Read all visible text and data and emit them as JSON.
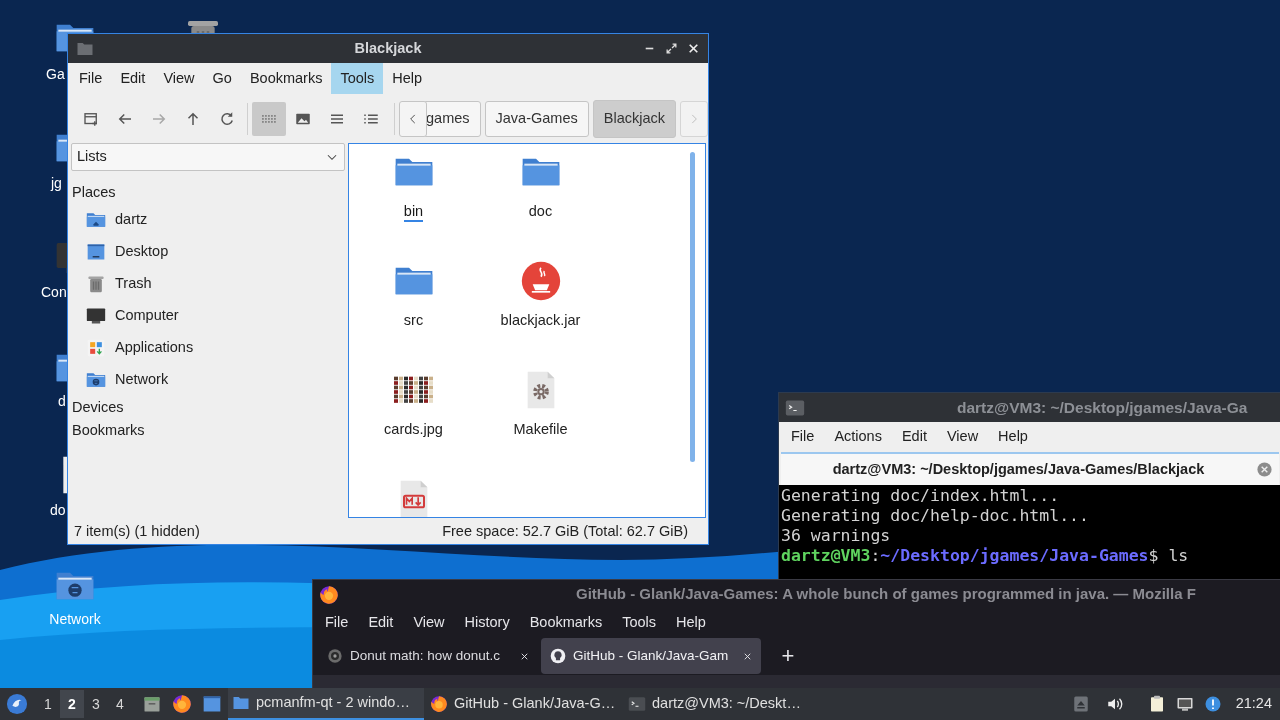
{
  "desktop": {
    "icons": [
      {
        "kind": "folder",
        "label": "Ga"
      },
      {
        "kind": "trash"
      },
      {
        "kind": "folder",
        "label": "jg"
      },
      {
        "kind": "computer",
        "label": "Con"
      },
      {
        "kind": "folder",
        "label": "d"
      },
      {
        "kind": "document",
        "label": "do"
      },
      {
        "kind": "network",
        "label": "Network"
      }
    ]
  },
  "file_manager": {
    "title": "Blackjack",
    "menu": [
      {
        "label": "File",
        "selected": false
      },
      {
        "label": "Edit",
        "selected": false
      },
      {
        "label": "View",
        "selected": false
      },
      {
        "label": "Go",
        "selected": false
      },
      {
        "label": "Bookmarks",
        "selected": false
      },
      {
        "label": "Tools",
        "selected": true
      },
      {
        "label": "Help",
        "selected": false
      }
    ],
    "nav_buttons": [
      {
        "kind": "new-tab",
        "disabled": false
      },
      {
        "kind": "back",
        "disabled": false
      },
      {
        "kind": "forward",
        "disabled": true
      },
      {
        "kind": "up",
        "disabled": false
      },
      {
        "kind": "reload",
        "disabled": false
      }
    ],
    "view_modes": [
      {
        "kind": "icons",
        "selected": true
      },
      {
        "kind": "thumbnails",
        "selected": false
      },
      {
        "kind": "compact",
        "selected": false
      },
      {
        "kind": "details",
        "selected": false
      }
    ],
    "breadcrumbs": [
      {
        "label": "games",
        "selected": false
      },
      {
        "label": "Java-Games",
        "selected": false
      },
      {
        "label": "Blackjack",
        "selected": true
      }
    ],
    "sidebar": {
      "dropdown": "Lists",
      "sections": [
        {
          "label": "Places",
          "items": [
            {
              "label": "dartz",
              "kind": "home"
            },
            {
              "label": "Desktop",
              "kind": "desktop"
            },
            {
              "label": "Trash",
              "kind": "trash"
            },
            {
              "label": "Computer",
              "kind": "computer"
            },
            {
              "label": "Applications",
              "kind": "applications"
            },
            {
              "label": "Network",
              "kind": "network"
            }
          ]
        },
        {
          "label": "Devices"
        },
        {
          "label": "Bookmarks"
        }
      ]
    },
    "files": [
      {
        "name": "bin",
        "kind": "folder",
        "focused": true
      },
      {
        "name": "doc",
        "kind": "folder",
        "focused": false
      },
      {
        "name": "src",
        "kind": "folder",
        "focused": false
      },
      {
        "name": "blackjack.jar",
        "kind": "jar",
        "focused": false
      },
      {
        "name": "cards.jpg",
        "kind": "image",
        "focused": false
      },
      {
        "name": "Makefile",
        "kind": "makefile",
        "focused": false
      },
      {
        "kind": "markdown",
        "focused": false
      }
    ],
    "status_left": "7 item(s) (1 hidden)",
    "status_right": "Free space: 52.7 GiB (Total: 62.7 GiB)"
  },
  "terminal": {
    "title": "dartz@VM3: ~/Desktop/jgames/Java-Ga",
    "menu": [
      "File",
      "Actions",
      "Edit",
      "View",
      "Help"
    ],
    "tab_title": "dartz@VM3: ~/Desktop/jgames/Java-Games/Blackjack",
    "lines": [
      {
        "kind": "output",
        "text": "Generating doc/index.html..."
      },
      {
        "kind": "output",
        "text": "Generating doc/help-doc.html..."
      },
      {
        "kind": "output",
        "text": "36 warnings"
      },
      {
        "kind": "prompt",
        "user": "dartz@VM3",
        "separator": ":",
        "path": "~/Desktop/jgames/Java-Games",
        "command": "$ ls"
      }
    ]
  },
  "browser": {
    "title": "GitHub - Glank/Java-Games: A whole bunch of games programmed in java. — Mozilla F",
    "menu": [
      "File",
      "Edit",
      "View",
      "History",
      "Bookmarks",
      "Tools",
      "Help"
    ],
    "tabs": [
      {
        "label": "Donut math: how donut.c",
        "kind": "donut",
        "selected": false
      },
      {
        "label": "GitHub - Glank/Java-Gam",
        "kind": "github",
        "selected": true
      }
    ],
    "new_tab": "+"
  },
  "taskbar": {
    "workspaces": [
      {
        "label": "1",
        "selected": false
      },
      {
        "label": "2",
        "selected": true
      },
      {
        "label": "3",
        "selected": false
      },
      {
        "label": "4",
        "selected": false
      }
    ],
    "tasks": [
      {
        "label": "pcmanfm-qt - 2 windo…",
        "kind": "files",
        "selected": true
      },
      {
        "label": "GitHub - Glank/Java-G…",
        "kind": "firefox",
        "selected": false
      },
      {
        "label": "dartz@VM3: ~/Deskt…",
        "kind": "terminal",
        "selected": false
      }
    ],
    "clock": "21:24"
  }
}
